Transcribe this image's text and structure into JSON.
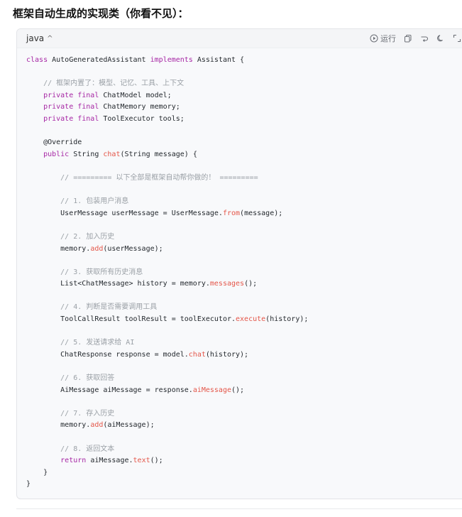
{
  "heading": "框架自动生成的实现类（你看不见）：",
  "code_block": {
    "language": "java",
    "language_chevron": "^",
    "run_label": "运行",
    "icons": [
      "play-icon",
      "copy-icon",
      "wrap-icon",
      "theme-icon",
      "expand-icon"
    ],
    "lines": [
      [
        [
          "k",
          "class "
        ],
        [
          "t",
          "AutoGeneratedAssistant "
        ],
        [
          "k",
          "implements "
        ],
        [
          "t",
          "Assistant {"
        ]
      ],
      [],
      [
        [
          "c",
          "    // 框架内置了：模型、记忆、工具、上下文"
        ]
      ],
      [
        [
          "k",
          "    private final "
        ],
        [
          "t",
          "ChatModel model;"
        ]
      ],
      [
        [
          "k",
          "    private final "
        ],
        [
          "t",
          "ChatMemory memory;"
        ]
      ],
      [
        [
          "k",
          "    private final "
        ],
        [
          "t",
          "ToolExecutor tools;"
        ]
      ],
      [],
      [
        [
          "a",
          "    @Override"
        ]
      ],
      [
        [
          "k",
          "    public "
        ],
        [
          "t",
          "String "
        ],
        [
          "f",
          "chat"
        ],
        [
          "t",
          "(String message) {"
        ]
      ],
      [],
      [
        [
          "c",
          "        // ========= 以下全部是框架自动帮你做的！ ========="
        ]
      ],
      [],
      [
        [
          "c",
          "        // 1. 包装用户消息"
        ]
      ],
      [
        [
          "t",
          "        UserMessage userMessage = UserMessage."
        ],
        [
          "f",
          "from"
        ],
        [
          "t",
          "(message);"
        ]
      ],
      [],
      [
        [
          "c",
          "        // 2. 加入历史"
        ]
      ],
      [
        [
          "t",
          "        memory."
        ],
        [
          "f",
          "add"
        ],
        [
          "t",
          "(userMessage);"
        ]
      ],
      [],
      [
        [
          "c",
          "        // 3. 获取所有历史消息"
        ]
      ],
      [
        [
          "t",
          "        List<ChatMessage> history = memory."
        ],
        [
          "f",
          "messages"
        ],
        [
          "t",
          "();"
        ]
      ],
      [],
      [
        [
          "c",
          "        // 4. 判断是否需要调用工具"
        ]
      ],
      [
        [
          "t",
          "        ToolCallResult toolResult = toolExecutor."
        ],
        [
          "f",
          "execute"
        ],
        [
          "t",
          "(history);"
        ]
      ],
      [],
      [
        [
          "c",
          "        // 5. 发送请求给 AI"
        ]
      ],
      [
        [
          "t",
          "        ChatResponse response = model."
        ],
        [
          "f",
          "chat"
        ],
        [
          "t",
          "(history);"
        ]
      ],
      [],
      [
        [
          "c",
          "        // 6. 获取回答"
        ]
      ],
      [
        [
          "t",
          "        AiMessage aiMessage = response."
        ],
        [
          "f",
          "aiMessage"
        ],
        [
          "t",
          "();"
        ]
      ],
      [],
      [
        [
          "c",
          "        // 7. 存入历史"
        ]
      ],
      [
        [
          "t",
          "        memory."
        ],
        [
          "f",
          "add"
        ],
        [
          "t",
          "(aiMessage);"
        ]
      ],
      [],
      [
        [
          "c",
          "        // 8. 返回文本"
        ]
      ],
      [
        [
          "k",
          "        return "
        ],
        [
          "t",
          "aiMessage."
        ],
        [
          "f",
          "text"
        ],
        [
          "t",
          "();"
        ]
      ],
      [
        [
          "t",
          "    }"
        ]
      ],
      [
        [
          "t",
          "}"
        ]
      ]
    ]
  },
  "colors": {
    "keyword": "#a626a4",
    "function": "#e45649",
    "comment": "#9aa0a6",
    "text": "#24292e"
  }
}
